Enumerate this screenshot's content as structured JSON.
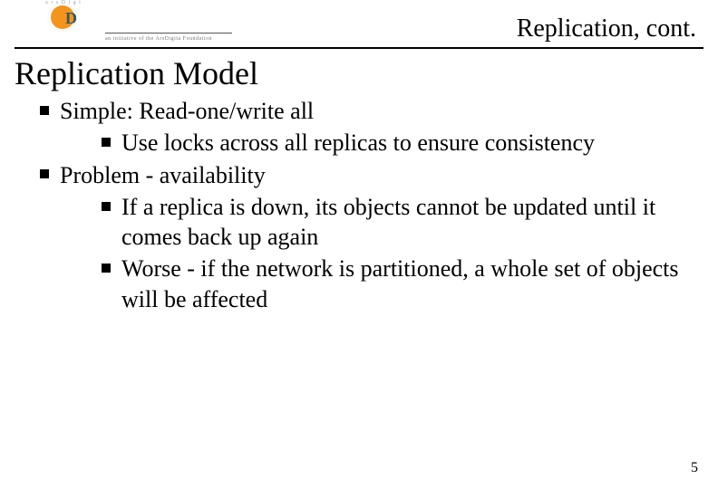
{
  "header": {
    "logo_arc_text": "a r s D i g i t a",
    "logo_letter_a": "a",
    "logo_letter_D": "D",
    "logo_subtext": "an initiative of the ArsDigita Foundation",
    "title": "Replication, cont."
  },
  "section_title": "Replication Model",
  "bullets": [
    {
      "text": "Simple: Read-one/write all",
      "sub": [
        "Use locks across all replicas to ensure consistency"
      ]
    },
    {
      "text": "Problem - availability",
      "sub": [
        "If a replica is down, its objects cannot be updated until it comes back up again",
        "Worse - if the network is partitioned, a whole set of objects will be affected"
      ]
    }
  ],
  "page_number": "5"
}
